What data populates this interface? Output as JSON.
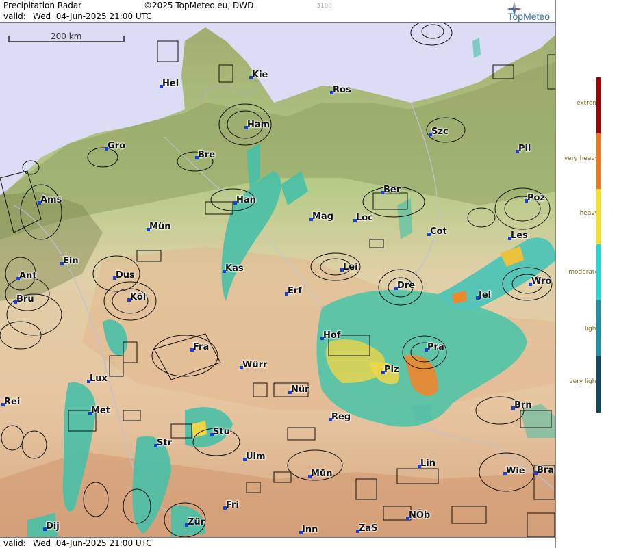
{
  "header": {
    "title": "Precipitation Radar",
    "copyright": "©2025 TopMeteo.eu, DWD",
    "id_code": "3100",
    "valid_label": "valid:",
    "valid_time": "Wed  04-Jun-2025 21:00 UTC"
  },
  "footer": {
    "valid_label": "valid:",
    "valid_time": "Wed  04-Jun-2025 21:00 UTC"
  },
  "logo": {
    "text": "TopMeteo",
    "icon": "compass-star-icon"
  },
  "scale": {
    "label": "200 km"
  },
  "cities": [
    {
      "name": "Kie"
    },
    {
      "name": "Hel"
    },
    {
      "name": "Ros"
    },
    {
      "name": "Ham"
    },
    {
      "name": "Szc"
    },
    {
      "name": "Gro"
    },
    {
      "name": "Bre"
    },
    {
      "name": "Pil"
    },
    {
      "name": "Ber"
    },
    {
      "name": "Poz"
    },
    {
      "name": "Ams"
    },
    {
      "name": "Han"
    },
    {
      "name": "Mag"
    },
    {
      "name": "Loc"
    },
    {
      "name": "Mün"
    },
    {
      "name": "Cot"
    },
    {
      "name": "Les"
    },
    {
      "name": "Ein"
    },
    {
      "name": "Kas"
    },
    {
      "name": "Lei"
    },
    {
      "name": "Ant"
    },
    {
      "name": "Dus"
    },
    {
      "name": "Wro"
    },
    {
      "name": "Dre"
    },
    {
      "name": "Bru"
    },
    {
      "name": "Köl"
    },
    {
      "name": "Erf"
    },
    {
      "name": "Jel"
    },
    {
      "name": "Hof"
    },
    {
      "name": "Fra"
    },
    {
      "name": "Pra"
    },
    {
      "name": "Würr"
    },
    {
      "name": "Plz"
    },
    {
      "name": "Lux"
    },
    {
      "name": "Nür"
    },
    {
      "name": "Rei"
    },
    {
      "name": "Met"
    },
    {
      "name": "Brn"
    },
    {
      "name": "Reg"
    },
    {
      "name": "Stu"
    },
    {
      "name": "Str"
    },
    {
      "name": "Ulm"
    },
    {
      "name": "Lin"
    },
    {
      "name": "Mün"
    },
    {
      "name": "Wie"
    },
    {
      "name": "Bra"
    },
    {
      "name": "Fri"
    },
    {
      "name": "Dij"
    },
    {
      "name": "Zür"
    },
    {
      "name": "NÖb"
    },
    {
      "name": "Inn"
    },
    {
      "name": "ZaS"
    }
  ],
  "legend": {
    "levels": [
      {
        "label": "extrem",
        "color": "#a80000"
      },
      {
        "label": "very heavy",
        "color": "#f07818"
      },
      {
        "label": "heavy",
        "color": "#f8e020"
      },
      {
        "label": "moderate",
        "color": "#20d8d8"
      },
      {
        "label": "light",
        "color": "#1890a8"
      },
      {
        "label": "very light",
        "color": "#104860"
      }
    ]
  },
  "colors": {
    "sea": "#dcdcf4",
    "lowland": "#8a9a5a",
    "plain": "#b8cc8a",
    "hills": "#e8c8a0",
    "mountains": "#d8a880",
    "radar_light": "#50c8b0",
    "radar_moderate": "#30c8d0",
    "radar_heavy": "#f0d840",
    "radar_veryheavy": "#f08020",
    "city_dot": "#1840d8"
  }
}
